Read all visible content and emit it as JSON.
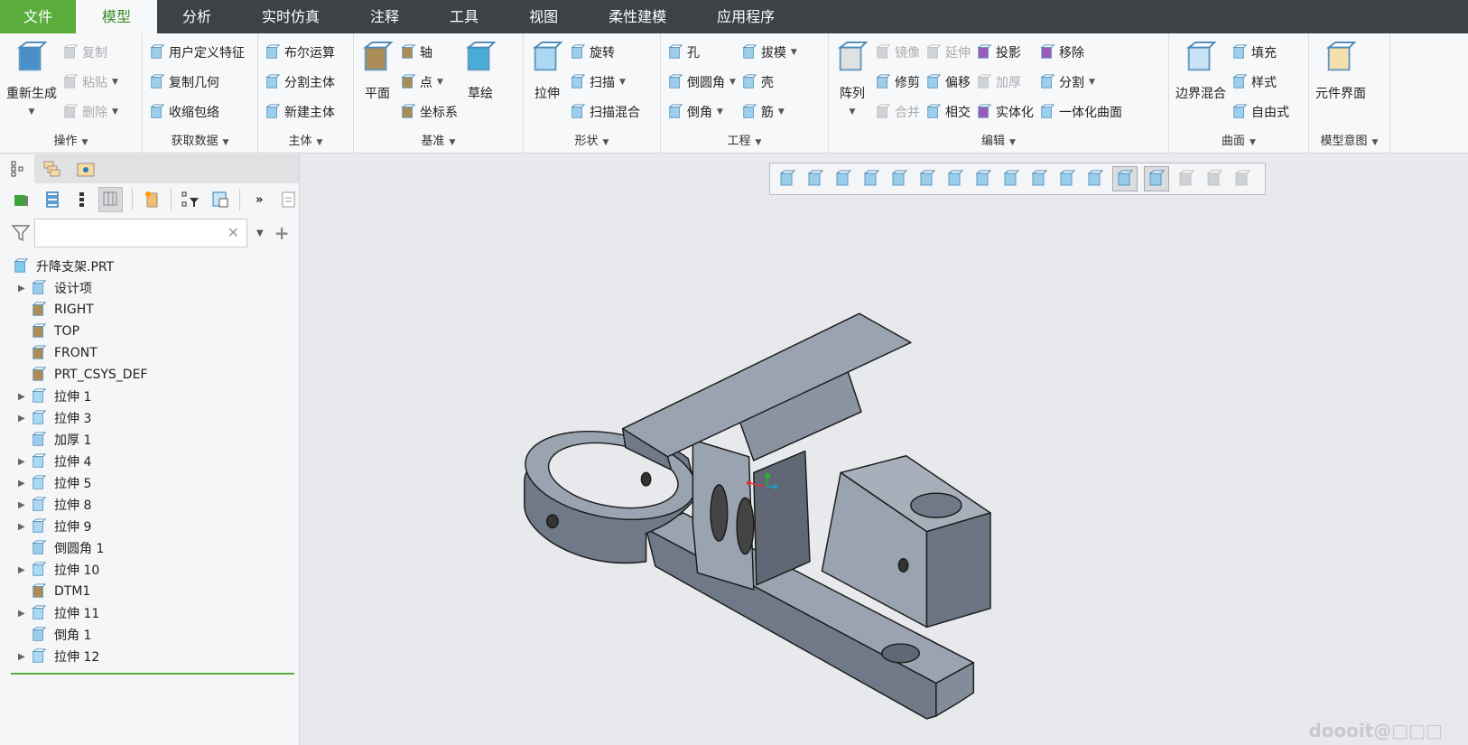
{
  "tabs": [
    "文件",
    "模型",
    "分析",
    "实时仿真",
    "注释",
    "工具",
    "视图",
    "柔性建模",
    "应用程序"
  ],
  "active_tab": 1,
  "ribbon": [
    {
      "label": "操作",
      "width": 158,
      "cols": [
        {
          "big": true,
          "items": [
            {
              "label": "重新生成",
              "icon": "regenerate-icon",
              "dd": true
            }
          ]
        },
        {
          "items": [
            {
              "label": "复制",
              "icon": "copy-icon",
              "dis": true
            },
            {
              "label": "粘贴",
              "icon": "paste-icon",
              "dis": true,
              "dd": true
            },
            {
              "label": "删除",
              "icon": "delete-icon",
              "dis": true,
              "dd": true
            }
          ]
        }
      ]
    },
    {
      "label": "获取数据",
      "width": 128,
      "cols": [
        {
          "items": [
            {
              "label": "用户定义特征",
              "icon": "udf-icon"
            },
            {
              "label": "复制几何",
              "icon": "copy-geometry-icon"
            },
            {
              "label": "收缩包络",
              "icon": "shrinkwrap-icon"
            }
          ]
        }
      ]
    },
    {
      "label": "主体",
      "width": 106,
      "cols": [
        {
          "items": [
            {
              "label": "布尔运算",
              "icon": "boolean-icon"
            },
            {
              "label": "分割主体",
              "icon": "split-body-icon"
            },
            {
              "label": "新建主体",
              "icon": "new-body-icon"
            }
          ]
        }
      ]
    },
    {
      "label": "基准",
      "width": 188,
      "cols": [
        {
          "big": true,
          "items": [
            {
              "label": "平面",
              "icon": "plane-icon"
            }
          ]
        },
        {
          "items": [
            {
              "label": "轴",
              "icon": "axis-icon"
            },
            {
              "label": "点",
              "icon": "point-icon",
              "dd": true
            },
            {
              "label": "坐标系",
              "icon": "csys-icon"
            }
          ]
        },
        {
          "big": true,
          "items": [
            {
              "label": "草绘",
              "icon": "sketch-icon"
            }
          ]
        }
      ]
    },
    {
      "label": "形状",
      "width": 152,
      "cols": [
        {
          "big": true,
          "items": [
            {
              "label": "拉伸",
              "icon": "extrude-icon"
            }
          ]
        },
        {
          "items": [
            {
              "label": "旋转",
              "icon": "revolve-icon"
            },
            {
              "label": "扫描",
              "icon": "sweep-icon",
              "dd": true
            },
            {
              "label": "扫描混合",
              "icon": "swept-blend-icon"
            }
          ]
        }
      ]
    },
    {
      "label": "工程",
      "width": 186,
      "cols": [
        {
          "items": [
            {
              "label": "孔",
              "icon": "hole-icon"
            },
            {
              "label": "倒圆角",
              "icon": "round-icon",
              "dd": true
            },
            {
              "label": "倒角",
              "icon": "chamfer-icon",
              "dd": true
            }
          ]
        },
        {
          "items": [
            {
              "label": "拔模",
              "icon": "draft-icon",
              "dd": true
            },
            {
              "label": "壳",
              "icon": "shell-icon"
            },
            {
              "label": "筋",
              "icon": "rib-icon",
              "dd": true
            }
          ]
        }
      ]
    },
    {
      "label": "编辑",
      "width": 377,
      "cols": [
        {
          "big": true,
          "items": [
            {
              "label": "阵列",
              "icon": "pattern-icon",
              "dd": true
            }
          ]
        },
        {
          "items": [
            {
              "label": "镜像",
              "icon": "mirror-icon",
              "dis": true
            },
            {
              "label": "修剪",
              "icon": "trim-icon"
            },
            {
              "label": "合并",
              "icon": "merge-icon",
              "dis": true
            }
          ]
        },
        {
          "items": [
            {
              "label": "延伸",
              "icon": "extend-icon",
              "dis": true
            },
            {
              "label": "偏移",
              "icon": "offset-icon"
            },
            {
              "label": "相交",
              "icon": "intersect-icon"
            }
          ]
        },
        {
          "items": [
            {
              "label": "投影",
              "icon": "project-icon"
            },
            {
              "label": "加厚",
              "icon": "thicken-icon",
              "dis": true
            },
            {
              "label": "实体化",
              "icon": "solidify-icon"
            }
          ]
        },
        {
          "items": [
            {
              "label": "移除",
              "icon": "remove-icon"
            },
            {
              "label": "分割",
              "icon": "split-icon",
              "dd": true
            },
            {
              "label": "一体化曲面",
              "icon": "unified-surface-icon"
            }
          ]
        }
      ]
    },
    {
      "label": "曲面",
      "width": 155,
      "cols": [
        {
          "big": true,
          "items": [
            {
              "label": "边界混合",
              "icon": "boundary-blend-icon"
            }
          ]
        },
        {
          "items": [
            {
              "label": "填充",
              "icon": "fill-icon"
            },
            {
              "label": "样式",
              "icon": "style-icon"
            },
            {
              "label": "自由式",
              "icon": "freestyle-icon"
            }
          ]
        }
      ]
    },
    {
      "label": "模型意图",
      "width": 90,
      "cols": [
        {
          "big": true,
          "items": [
            {
              "label": "元件界面",
              "icon": "component-interface-icon"
            }
          ]
        }
      ]
    }
  ],
  "search": {
    "value": "",
    "placeholder": ""
  },
  "tree": [
    {
      "label": "升降支架.PRT",
      "icon": "part-icon",
      "root": true
    },
    {
      "label": "设计项",
      "icon": "design-items-icon",
      "exp": true
    },
    {
      "label": "RIGHT",
      "icon": "datum-plane-icon"
    },
    {
      "label": "TOP",
      "icon": "datum-plane-icon"
    },
    {
      "label": "FRONT",
      "icon": "datum-plane-icon"
    },
    {
      "label": "PRT_CSYS_DEF",
      "icon": "csys-icon"
    },
    {
      "label": "拉伸 1",
      "icon": "extrude-icon",
      "exp": true
    },
    {
      "label": "拉伸 3",
      "icon": "extrude-icon",
      "exp": true
    },
    {
      "label": "加厚 1",
      "icon": "thicken-icon"
    },
    {
      "label": "拉伸 4",
      "icon": "extrude-icon",
      "exp": true
    },
    {
      "label": "拉伸 5",
      "icon": "extrude-icon",
      "exp": true
    },
    {
      "label": "拉伸 8",
      "icon": "extrude-icon",
      "exp": true
    },
    {
      "label": "拉伸 9",
      "icon": "extrude-icon",
      "exp": true
    },
    {
      "label": "倒圆角 1",
      "icon": "round-icon"
    },
    {
      "label": "拉伸 10",
      "icon": "extrude-icon",
      "exp": true
    },
    {
      "label": "DTM1",
      "icon": "datum-plane-icon"
    },
    {
      "label": "拉伸 11",
      "icon": "extrude-icon",
      "exp": true
    },
    {
      "label": "倒角 1",
      "icon": "chamfer-icon"
    },
    {
      "label": "拉伸 12",
      "icon": "extrude-icon",
      "exp": true
    }
  ],
  "view_tools": [
    "refit-icon",
    "zoom-in-icon",
    "zoom-out-icon",
    "repaint-icon",
    "display-style-icon",
    "saved-orientations-icon",
    "view-manager-icon",
    "annotation-snapshot-icon",
    "spin-center-icon",
    "perspective-icon",
    "datum-display-icon",
    "point-display-icon",
    "annotation-display-icon",
    "csys-display-icon",
    "simulation-icon",
    "pause-icon",
    "section-icon"
  ],
  "view_tools_on": [
    12,
    13
  ],
  "watermark": "doooit@□□□",
  "colors": {
    "accent": "#5aad3c",
    "model_fill": "#9aa3b0",
    "model_dark": "#707987"
  }
}
